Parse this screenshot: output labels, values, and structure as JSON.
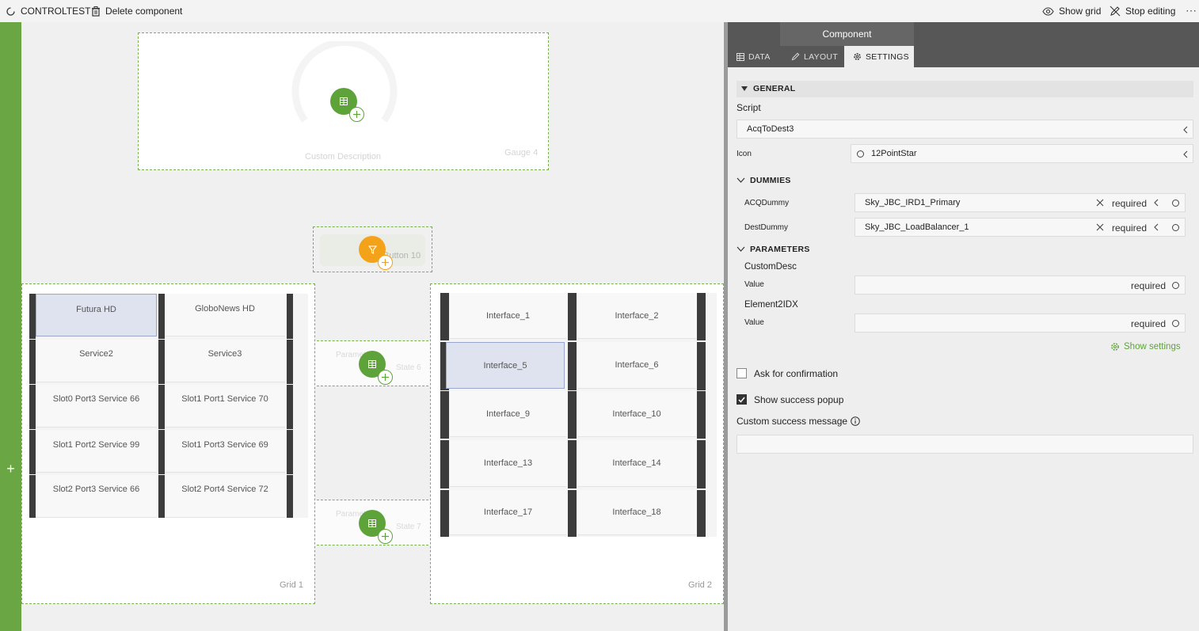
{
  "topbar": {
    "app_name": "CONTROLTEST",
    "delete_label": "Delete component",
    "show_grid_label": "Show grid",
    "stop_editing_label": "Stop editing",
    "more_label": "⋯"
  },
  "canvas": {
    "gauge": {
      "caption": "Custom Description",
      "label": "Gauge 4"
    },
    "button10": {
      "label": "Button 10"
    },
    "mid_component1": {
      "text": "Parameter",
      "label": "State 6"
    },
    "mid_component2": {
      "text": "Parameter",
      "label": "State 7"
    },
    "grid1": {
      "label": "Grid 1",
      "rows": [
        [
          "Futura HD",
          "GloboNews HD"
        ],
        [
          "Service2",
          "Service3"
        ],
        [
          "Slot0 Port3 Service 66",
          "Slot1 Port1 Service 70"
        ],
        [
          "Slot1 Port2 Service 99",
          "Slot1 Port3 Service 69"
        ],
        [
          "Slot2 Port3 Service 66",
          "Slot2 Port4 Service 72"
        ]
      ]
    },
    "grid2": {
      "label": "Grid 2",
      "rows": [
        [
          "Interface_1",
          "Interface_2"
        ],
        [
          "Interface_5",
          "Interface_6"
        ],
        [
          "Interface_9",
          "Interface_10"
        ],
        [
          "Interface_13",
          "Interface_14"
        ],
        [
          "Interface_17",
          "Interface_18"
        ]
      ]
    }
  },
  "panel": {
    "title": "Component",
    "tabs": [
      "DATA",
      "LAYOUT",
      "SETTINGS"
    ],
    "general": {
      "heading": "GENERAL",
      "script_label": "Script",
      "script_value": "AcqToDest3",
      "icon_label": "Icon",
      "icon_value": "12PointStar"
    },
    "dummies": {
      "heading": "DUMMIES",
      "acq_label": "ACQDummy",
      "acq_value": "Sky_JBC_IRD1_Primary",
      "dest_label": "DestDummy",
      "dest_value": "Sky_JBC_LoadBalancer_1",
      "required": "required"
    },
    "parameters": {
      "heading": "PARAMETERS",
      "p1_name": "CustomDesc",
      "p2_name": "Element2IDX",
      "value_label": "Value",
      "required": "required",
      "show_settings": "Show settings"
    },
    "ask_confirmation": {
      "label": "Ask for confirmation",
      "checked": false
    },
    "show_success": {
      "label": "Show success popup",
      "checked": true
    },
    "custom_success_label": "Custom success message"
  },
  "colors": {
    "accent_green": "#6aa744",
    "orange": "#f4a21a",
    "header_dark": "#575757"
  }
}
